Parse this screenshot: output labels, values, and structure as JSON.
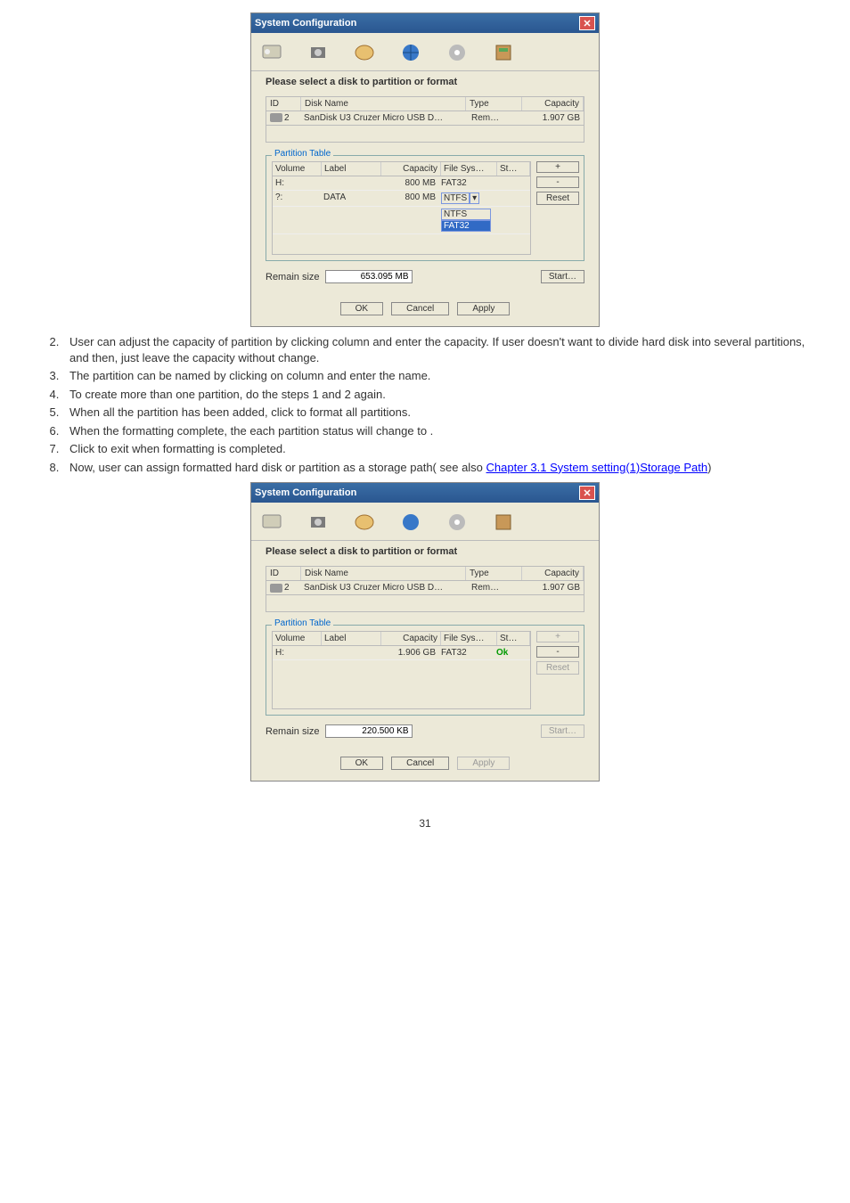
{
  "dialog": {
    "title": "System Configuration",
    "instruction": "Please select a disk to partition or format",
    "disk_headers": {
      "id": "ID",
      "name": "Disk Name",
      "type": "Type",
      "cap": "Capacity"
    },
    "disk_row": {
      "id": "2",
      "name": "SanDisk U3 Cruzer Micro USB D…",
      "type": "Rem…",
      "cap": "1.907 GB"
    },
    "pt_legend": "Partition Table",
    "pt_headers": {
      "vol": "Volume",
      "lab": "Label",
      "cap": "Capacity",
      "fs": "File Sys…",
      "st": "St…"
    },
    "A": {
      "rows": [
        {
          "vol": "H:",
          "lab": "",
          "cap": "800 MB",
          "fs": "FAT32",
          "st": ""
        },
        {
          "vol": "?:",
          "lab": "DATA",
          "cap": "800 MB",
          "fs": "NTFS",
          "st": ""
        }
      ],
      "fs_opts": [
        "NTFS",
        "FAT32"
      ],
      "remain": "653.095 MB",
      "start_enabled": true,
      "apply_enabled": true
    },
    "B": {
      "rows": [
        {
          "vol": "H:",
          "lab": "",
          "cap": "1.906 GB",
          "fs": "FAT32",
          "st": "Ok"
        }
      ],
      "remain": "220.500 KB",
      "start_enabled": false,
      "apply_enabled": false
    },
    "btn": {
      "plus": "+",
      "minus": "-",
      "reset": "Reset",
      "start": "Start…",
      "ok": "OK",
      "cancel": "Cancel",
      "apply": "Apply",
      "remain": "Remain size"
    }
  },
  "list": {
    "i2": "User can adjust the capacity of partition by clicking            column and enter the capacity. If user doesn't want to divide hard disk into several partitions, and then, just leave the capacity without change.",
    "i3": "The partition can be named by clicking on         column and enter the name.",
    "i4": "To create more than one partition, do the steps 1 and 2 again.",
    "i5": "When all the partition has been added, click         to format all partitions.",
    "i6": "When the formatting complete, the each partition status will change to    .",
    "i7": "Click       to exit when formatting is completed.",
    "i8a": "Now, user can assign formatted hard disk or partition as a storage path( see also ",
    "i8link": "Chapter 3.1 System setting(1)Storage Path",
    "i8b": ")"
  },
  "pagenum": "31"
}
